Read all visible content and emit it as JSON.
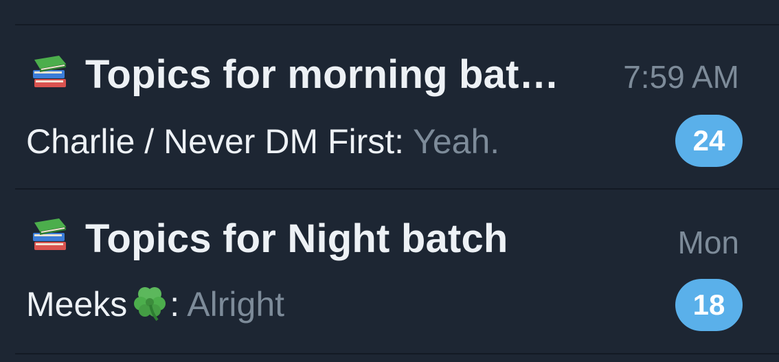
{
  "chats": [
    {
      "title": "Topics for morning bat…",
      "time": "7:59 AM",
      "sender": "Charlie / Never DM First:",
      "message": " Yeah.",
      "unread": "24",
      "icon": "books-icon"
    },
    {
      "title": "Topics for Night batch",
      "time": "Mon",
      "sender": "Meeks",
      "sender_emoji": "four-leaf-clover-icon",
      "separator": ":",
      "message": " Alright",
      "unread": "18",
      "icon": "books-icon"
    }
  ],
  "colors": {
    "background": "#1d2633",
    "title_text": "#edf1f5",
    "secondary_text": "#7d8b99",
    "badge": "#5ab0ea"
  }
}
